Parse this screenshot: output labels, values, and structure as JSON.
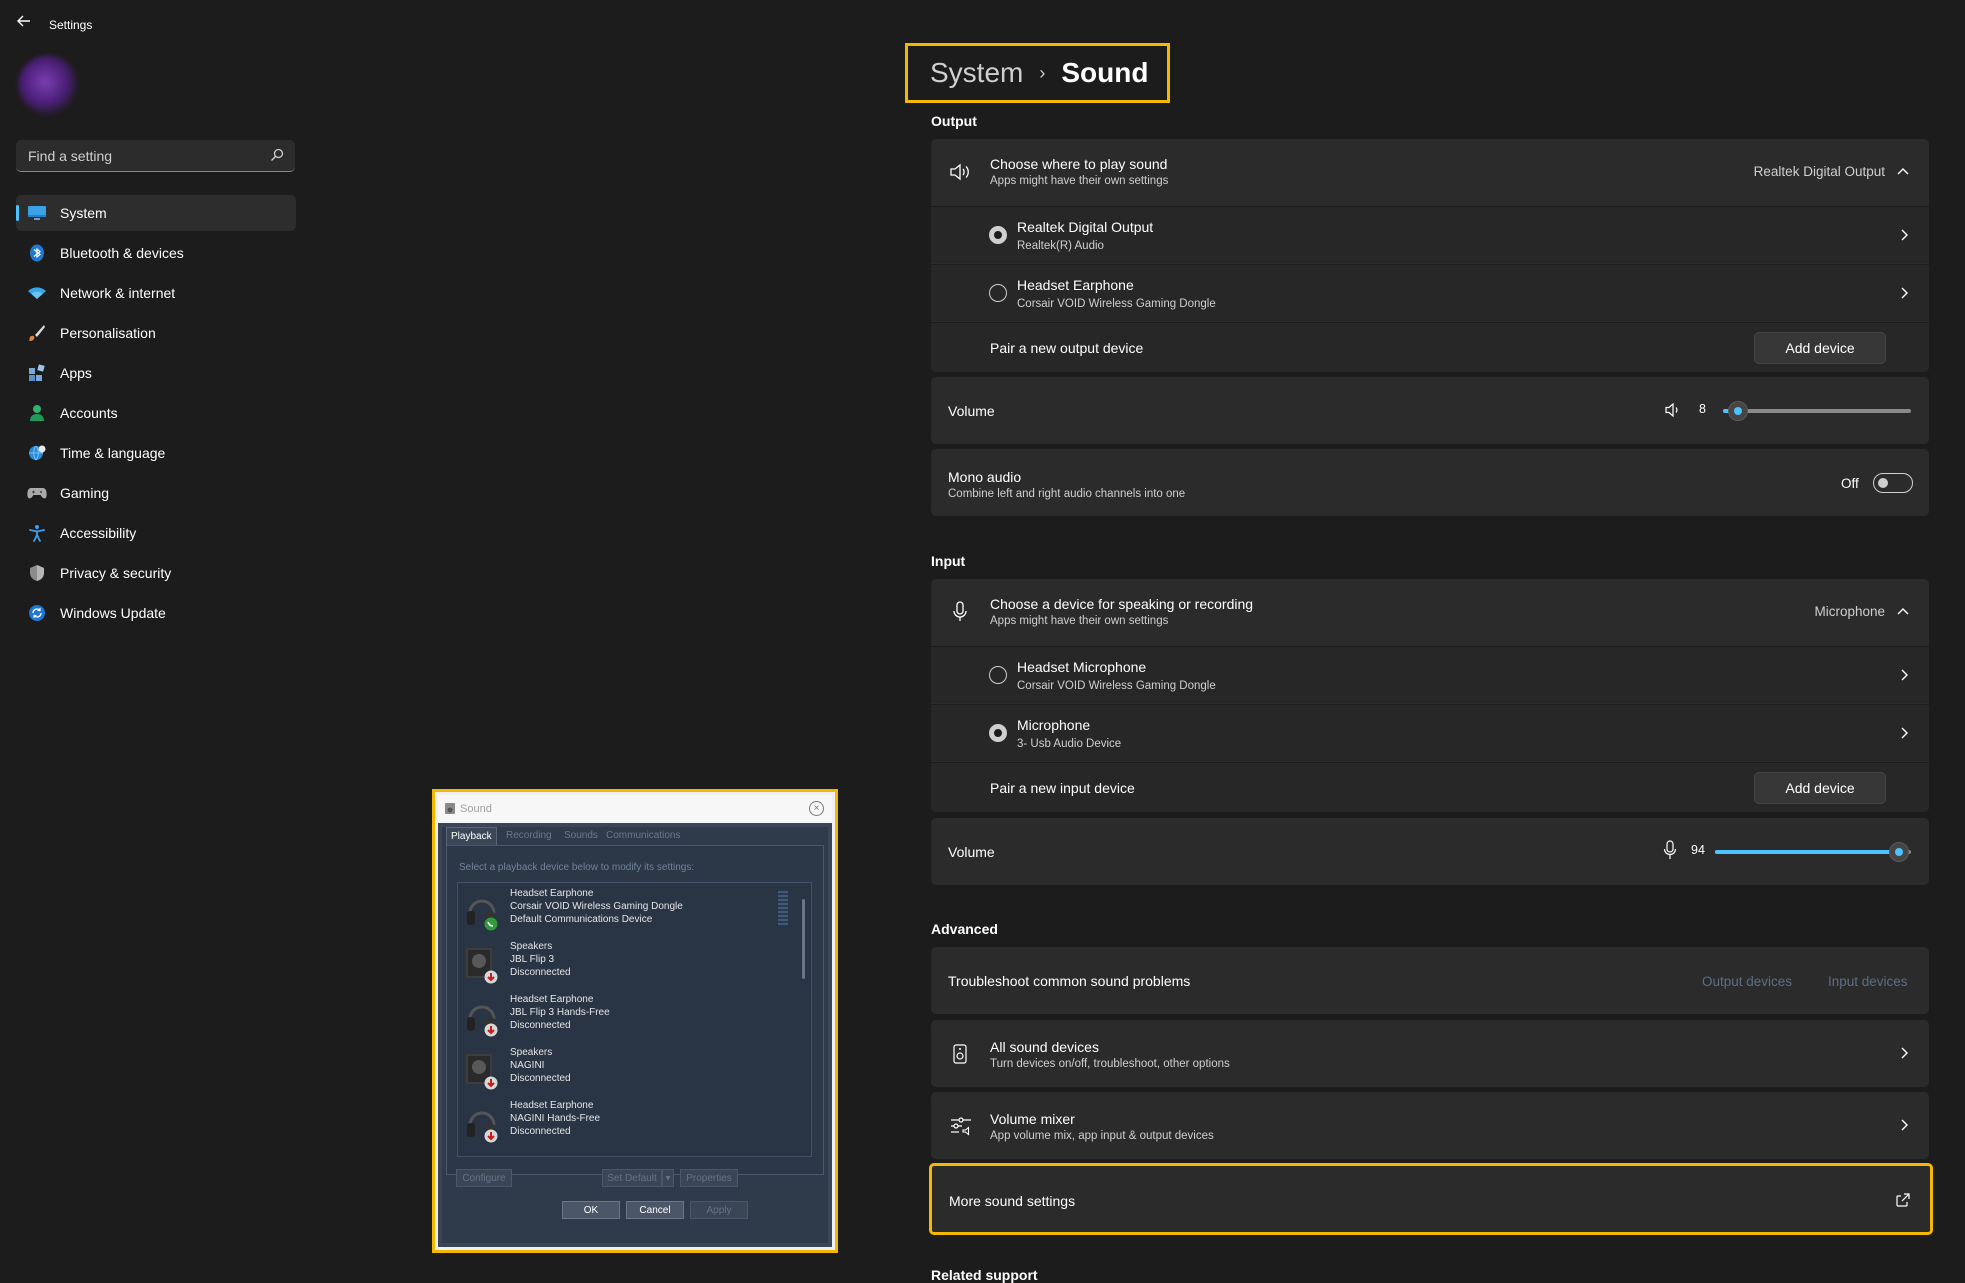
{
  "app": {
    "title": "Settings"
  },
  "search": {
    "placeholder": "Find a setting"
  },
  "nav": [
    {
      "label": "System",
      "icon": "monitor-icon",
      "active": true
    },
    {
      "label": "Bluetooth & devices",
      "icon": "bluetooth-icon"
    },
    {
      "label": "Network & internet",
      "icon": "wifi-icon"
    },
    {
      "label": "Personalisation",
      "icon": "brush-icon"
    },
    {
      "label": "Apps",
      "icon": "apps-icon"
    },
    {
      "label": "Accounts",
      "icon": "person-icon"
    },
    {
      "label": "Time & language",
      "icon": "globe-clock-icon"
    },
    {
      "label": "Gaming",
      "icon": "gamepad-icon"
    },
    {
      "label": "Accessibility",
      "icon": "accessibility-icon"
    },
    {
      "label": "Privacy & security",
      "icon": "shield-icon"
    },
    {
      "label": "Windows Update",
      "icon": "update-icon"
    }
  ],
  "breadcrumb": {
    "parent": "System",
    "separator": "›",
    "current": "Sound"
  },
  "output": {
    "section": "Output",
    "choose_title": "Choose where to play sound",
    "choose_sub": "Apps might have their own settings",
    "selected": "Realtek Digital Output",
    "devices": [
      {
        "name": "Realtek Digital Output",
        "sub": "Realtek(R) Audio",
        "selected": true
      },
      {
        "name": "Headset Earphone",
        "sub": "Corsair VOID Wireless Gaming Dongle",
        "selected": false
      }
    ],
    "pair_label": "Pair a new output device",
    "add_button": "Add device",
    "volume_label": "Volume",
    "volume_value": "8",
    "volume_level": 0.08,
    "mono_title": "Mono audio",
    "mono_sub": "Combine left and right audio channels into one",
    "mono_state": "Off"
  },
  "input": {
    "section": "Input",
    "choose_title": "Choose a device for speaking or recording",
    "choose_sub": "Apps might have their own settings",
    "selected": "Microphone",
    "devices": [
      {
        "name": "Headset Microphone",
        "sub": "Corsair VOID Wireless Gaming Dongle",
        "selected": false
      },
      {
        "name": "Microphone",
        "sub": "3- Usb Audio Device",
        "selected": true
      }
    ],
    "pair_label": "Pair a new input device",
    "add_button": "Add device",
    "volume_label": "Volume",
    "volume_value": "94",
    "volume_level": 0.94
  },
  "advanced": {
    "section": "Advanced",
    "troubleshoot": "Troubleshoot common sound problems",
    "output_devices": "Output devices",
    "input_devices": "Input devices",
    "all_devices_title": "All sound devices",
    "all_devices_sub": "Turn devices on/off, troubleshoot, other options",
    "mixer_title": "Volume mixer",
    "mixer_sub": "App volume mix, app input & output devices",
    "more_settings": "More sound settings"
  },
  "related": {
    "section": "Related support"
  },
  "dialog": {
    "title": "Sound",
    "tabs": [
      "Playback",
      "Recording",
      "Sounds",
      "Communications"
    ],
    "hint": "Select a playback device below to modify its settings:",
    "devices": [
      {
        "line1": "Headset Earphone",
        "line2": "Corsair VOID Wireless Gaming Dongle",
        "line3": "Default Communications Device",
        "kind": "headset",
        "status": "phone"
      },
      {
        "line1": "Speakers",
        "line2": "JBL Flip 3",
        "line3": "Disconnected",
        "kind": "speaker",
        "status": "down"
      },
      {
        "line1": "Headset Earphone",
        "line2": "JBL Flip 3 Hands-Free",
        "line3": "Disconnected",
        "kind": "headset",
        "status": "down"
      },
      {
        "line1": "Speakers",
        "line2": "NAGINI",
        "line3": "Disconnected",
        "kind": "speaker",
        "status": "down"
      },
      {
        "line1": "Headset Earphone",
        "line2": "NAGINI Hands-Free",
        "line3": "Disconnected",
        "kind": "headset",
        "status": "down"
      }
    ],
    "configure": "Configure",
    "set_default": "Set Default",
    "properties": "Properties",
    "ok": "OK",
    "cancel": "Cancel",
    "apply": "Apply"
  },
  "colors": {
    "accent": "#4cc2ff",
    "highlight": "#f5b800",
    "background": "#1c1c1c",
    "card": "#2b2b2b"
  }
}
